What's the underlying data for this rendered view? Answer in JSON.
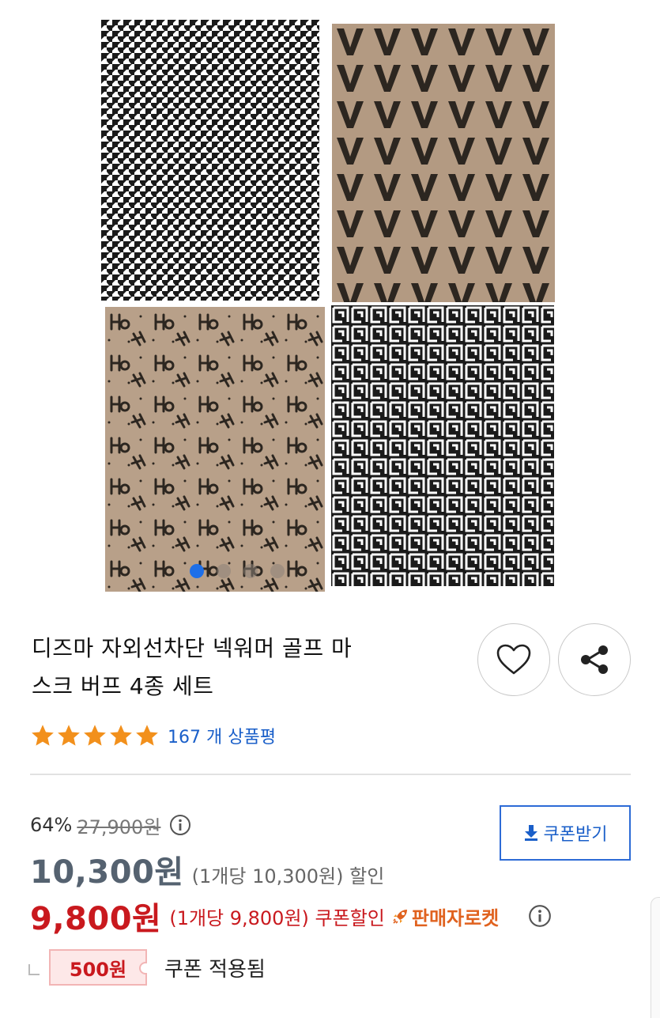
{
  "gallery": {
    "images": [
      {
        "icon": "houndstooth-pattern",
        "colors": [
          "#ffffff",
          "#1a1a1a"
        ]
      },
      {
        "icon": "v-letter-pattern",
        "colors": [
          "#b39a82",
          "#2c2620"
        ]
      },
      {
        "icon": "ho-script-pattern",
        "colors": [
          "#b8a089",
          "#2c2620"
        ]
      },
      {
        "icon": "maze-pattern",
        "colors": [
          "#1a1a1a",
          "#ffffff"
        ]
      }
    ],
    "current_page": 1,
    "total_pages": 4
  },
  "product": {
    "title_line1": "디즈마 자외선차단 넥워머 골프 마",
    "title_line2": "스크 버프 4종 세트"
  },
  "rating": {
    "stars": 5,
    "review_count": "167",
    "review_suffix": "개 상품평"
  },
  "actions": {
    "wish_icon": "heart-outline-icon",
    "share_icon": "share-icon"
  },
  "price": {
    "discount_percent": "64%",
    "original_price": "27,900원",
    "sale_price": "10,300원",
    "sale_unit": "(1개당 10,300원) 할인",
    "coupon_price": "9,800원",
    "coupon_unit": "(1개당 9,800원) 쿠폰할인",
    "seller_rocket": "판매자로켓",
    "coupon_amount": "500원",
    "coupon_applied": "쿠폰 적용됨"
  },
  "coupon_button": {
    "label": "쿠폰받기",
    "icon": "download-icon"
  },
  "colors": {
    "accent_blue": "#1a5fc9",
    "sale_red": "#c9191e",
    "star_orange": "#f2901c",
    "rocket_orange": "#e0621f"
  }
}
